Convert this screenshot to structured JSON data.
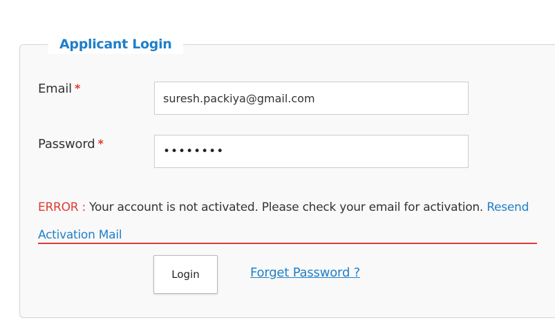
{
  "login_panel": {
    "title": "Applicant Login",
    "email": {
      "label": "Email",
      "required_mark": "*",
      "value": "suresh.packiya@gmail.com"
    },
    "password": {
      "label": "Password",
      "required_mark": "*",
      "value": "••••••••"
    },
    "error": {
      "label": "ERROR :",
      "message": "Your account is not activated. Please check your email for activation.",
      "link_text": "Resend Activation Mail"
    },
    "login_button": "Login",
    "forgot_link": "Forget Password ?"
  },
  "colors": {
    "accent": "#1f7fc8",
    "error": "#e03a2e",
    "panel_bg": "#f9f9f9",
    "border": "#d3d3d3"
  }
}
